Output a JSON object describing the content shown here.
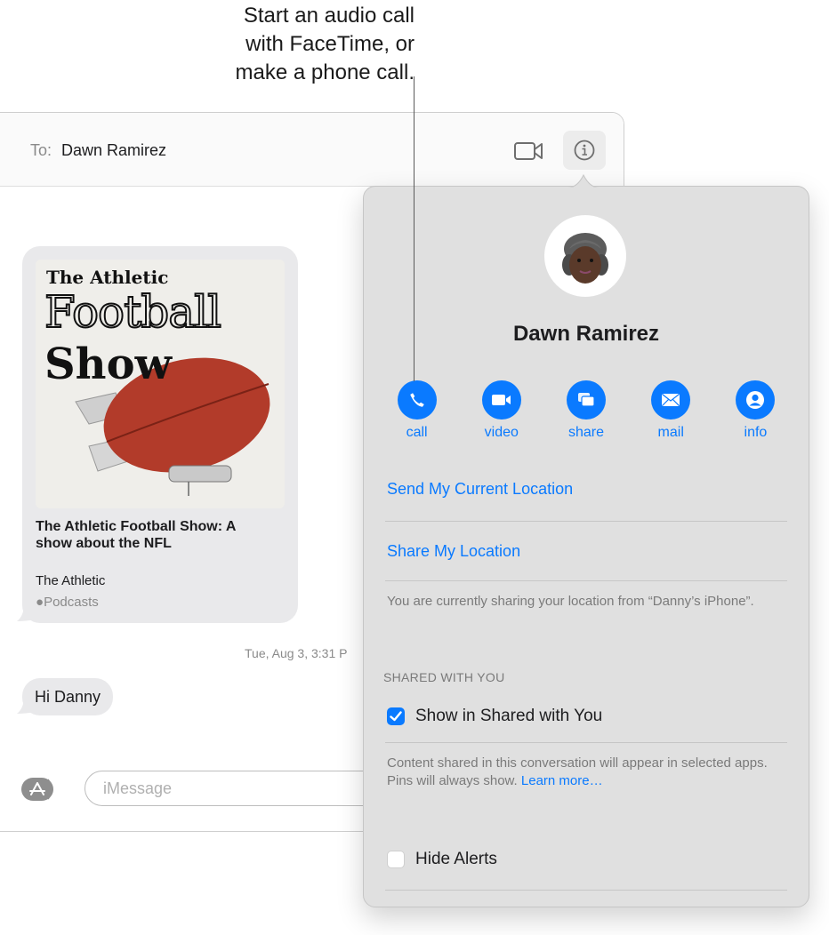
{
  "callout": {
    "lines": [
      "Start an audio call",
      "with FaceTime, or",
      "make a phone call."
    ]
  },
  "header": {
    "to_label": "To:",
    "recipient": "Dawn Ramirez",
    "video_icon": "video-camera-icon",
    "info_icon": "info-icon"
  },
  "conversation": {
    "card": {
      "art_brand": "The Athletic",
      "art_word1": "Football",
      "art_word2": "Show",
      "title": "The Athletic Football Show: A show about the NFL",
      "source": "The Athletic",
      "app": "Podcasts"
    },
    "timestamp": "Tue, Aug 3, 3:31 P",
    "message": "Hi Danny"
  },
  "compose": {
    "placeholder": "iMessage",
    "apps_icon": "app-store-icon"
  },
  "details": {
    "contact_name": "Dawn Ramirez",
    "actions": [
      {
        "label": "call",
        "icon": "phone-icon"
      },
      {
        "label": "video",
        "icon": "video-icon"
      },
      {
        "label": "share",
        "icon": "screen-share-icon"
      },
      {
        "label": "mail",
        "icon": "envelope-icon"
      },
      {
        "label": "info",
        "icon": "person-icon"
      }
    ],
    "send_location": "Send My Current Location",
    "share_location": "Share My Location",
    "location_note": "You are currently sharing your location from “Danny’s iPhone”.",
    "shared_header": "SHARED WITH YOU",
    "show_in_shared": {
      "label": "Show in Shared with You",
      "checked": true
    },
    "shared_note": "Content shared in this conversation will appear in selected apps. Pins will always show.",
    "learn_more": "Learn more…",
    "hide_alerts": {
      "label": "Hide Alerts",
      "checked": false
    }
  },
  "colors": {
    "accent": "#0a7aff",
    "popover_bg": "#e0e0e0",
    "bubble_bg": "#e9e9eb"
  }
}
